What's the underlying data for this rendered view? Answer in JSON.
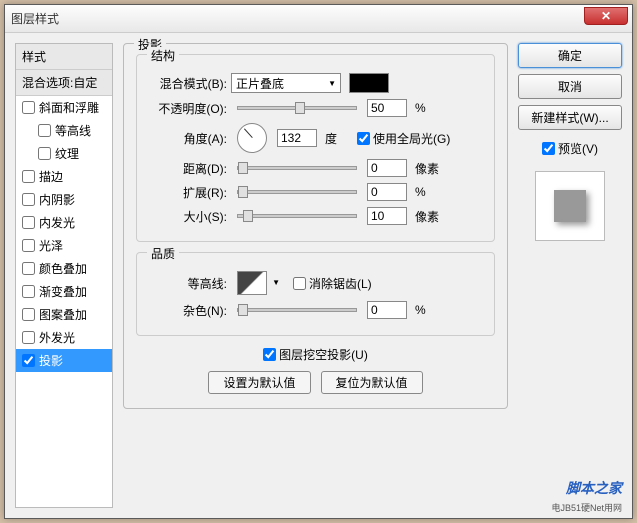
{
  "window": {
    "title": "图层样式"
  },
  "left": {
    "title": "样式",
    "blend": "混合选项:自定",
    "items": [
      {
        "label": "斜面和浮雕",
        "checked": false,
        "indent": false
      },
      {
        "label": "等高线",
        "checked": false,
        "indent": true
      },
      {
        "label": "纹理",
        "checked": false,
        "indent": true
      },
      {
        "label": "描边",
        "checked": false,
        "indent": false
      },
      {
        "label": "内阴影",
        "checked": false,
        "indent": false
      },
      {
        "label": "内发光",
        "checked": false,
        "indent": false
      },
      {
        "label": "光泽",
        "checked": false,
        "indent": false
      },
      {
        "label": "颜色叠加",
        "checked": false,
        "indent": false
      },
      {
        "label": "渐变叠加",
        "checked": false,
        "indent": false
      },
      {
        "label": "图案叠加",
        "checked": false,
        "indent": false
      },
      {
        "label": "外发光",
        "checked": false,
        "indent": false
      },
      {
        "label": "投影",
        "checked": true,
        "indent": false,
        "selected": true
      }
    ]
  },
  "main": {
    "title": "投影",
    "structure": {
      "legend": "结构",
      "blendModeLabel": "混合模式(B):",
      "blendModeValue": "正片叠底",
      "opacityLabel": "不透明度(O):",
      "opacityValue": "50",
      "opacityUnit": "%",
      "angleLabel": "角度(A):",
      "angleValue": "132",
      "angleUnit": "度",
      "globalLabel": "使用全局光(G)",
      "distanceLabel": "距离(D):",
      "distanceValue": "0",
      "spreadLabel": "扩展(R):",
      "spreadValue": "0",
      "sizeLabel": "大小(S):",
      "sizeValue": "10",
      "pxUnit": "像素",
      "pctUnit": "%"
    },
    "quality": {
      "legend": "品质",
      "contourLabel": "等高线:",
      "antialiasLabel": "消除锯齿(L)",
      "noiseLabel": "杂色(N):",
      "noiseValue": "0",
      "noiseUnit": "%"
    },
    "knockoutLabel": "图层挖空投影(U)",
    "btnDefault": "设置为默认值",
    "btnReset": "复位为默认值"
  },
  "right": {
    "ok": "确定",
    "cancel": "取消",
    "newStyle": "新建样式(W)...",
    "preview": "预览(V)"
  },
  "watermark": "脚本之家",
  "watermark2": "电JB51硬Net用网"
}
